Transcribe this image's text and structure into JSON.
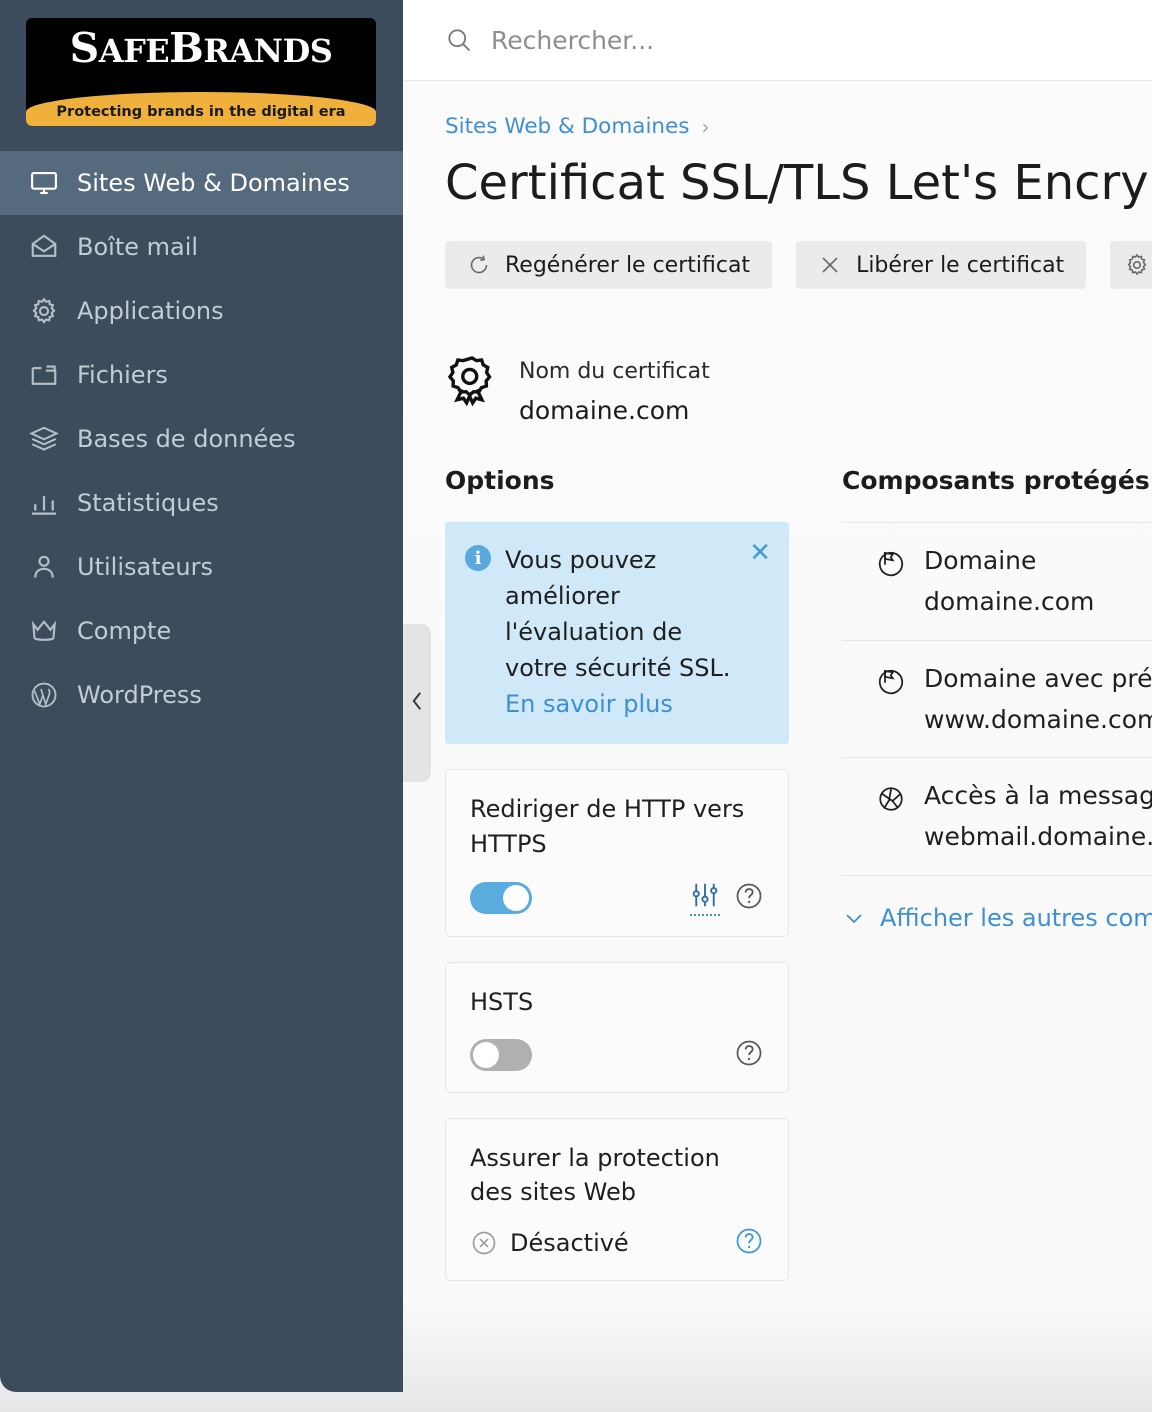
{
  "logo": {
    "name_part1": "S",
    "name_part2": "AFE",
    "name_part3": "B",
    "name_part4": "RANDS",
    "tagline": "Protecting brands in the digital era",
    "bg": "#000000",
    "band": "#f0b03c"
  },
  "sidebar": {
    "bg": "#3d4c5c",
    "active_bg": "#566a7e",
    "items": [
      {
        "label": "Sites Web & Domaines",
        "icon": "monitor-icon",
        "active": true
      },
      {
        "label": "Boîte mail",
        "icon": "envelope-icon",
        "active": false
      },
      {
        "label": "Applications",
        "icon": "gear-icon",
        "active": false
      },
      {
        "label": "Fichiers",
        "icon": "folder-icon",
        "active": false
      },
      {
        "label": "Bases de données",
        "icon": "database-layers-icon",
        "active": false
      },
      {
        "label": "Statistiques",
        "icon": "bar-chart-icon",
        "active": false
      },
      {
        "label": "Utilisateurs",
        "icon": "user-icon",
        "active": false
      },
      {
        "label": "Compte",
        "icon": "crown-icon",
        "active": false
      },
      {
        "label": "WordPress",
        "icon": "wordpress-icon",
        "active": false
      }
    ]
  },
  "collapse_handle": {
    "icon": "chevron-left-icon"
  },
  "search": {
    "placeholder": "Rechercher...",
    "value": "",
    "icon": "search-icon"
  },
  "breadcrumb": {
    "parent": "Sites Web & Domaines",
    "separator": "›"
  },
  "header": {
    "title": "Certificat SSL/TLS Let's Encrypt"
  },
  "toolbar": {
    "buttons": [
      {
        "label": "Regénérer le certificat",
        "icon": "refresh-icon"
      },
      {
        "label": "Libérer le certificat",
        "icon": "close-x-icon"
      },
      {
        "label": "",
        "icon": "gear-icon"
      }
    ]
  },
  "certificate": {
    "icon": "certificate-badge-icon",
    "label": "Nom du certificat",
    "value": "domaine.com"
  },
  "options": {
    "heading": "Options",
    "banner": {
      "icon": "info-icon",
      "text": "Vous pouvez améliorer l'évaluation de votre sécurité SSL. ",
      "link": "En savoir plus",
      "close_icon": "close-icon",
      "bg": "#cfe9f8",
      "link_color": "#3e8fd4"
    },
    "cards": [
      {
        "title": "Rediriger de HTTP vers HTTPS",
        "control": "toggle",
        "toggle_state": "on",
        "icons": [
          "sliders-icon",
          "help-icon"
        ],
        "sliders_color": "#3e8fd4",
        "help_color": "#595959"
      },
      {
        "title": "HSTS",
        "control": "toggle",
        "toggle_state": "off",
        "icons": [
          "help-icon"
        ],
        "help_color": "#595959"
      },
      {
        "title": "Assurer la protection des sites Web",
        "control": "status",
        "status_icon": "circle-x-icon",
        "status_text": "Désactivé",
        "icons": [
          "help-icon"
        ],
        "help_color": "#3e9ad6"
      }
    ]
  },
  "protected": {
    "heading": "Composants protégés",
    "rows": [
      {
        "icon": "flag-circle-icon",
        "name": "Domaine",
        "value": "domaine.com"
      },
      {
        "icon": "flag-circle-icon",
        "name": "Domaine avec préfixe www",
        "value": "www.domaine.com"
      },
      {
        "icon": "globe-mail-icon",
        "name": "Accès à la messagerie Web",
        "value": "webmail.domaine.com"
      }
    ],
    "show_more": {
      "label": "Afficher les autres composants",
      "icon": "chevron-down-icon"
    }
  }
}
